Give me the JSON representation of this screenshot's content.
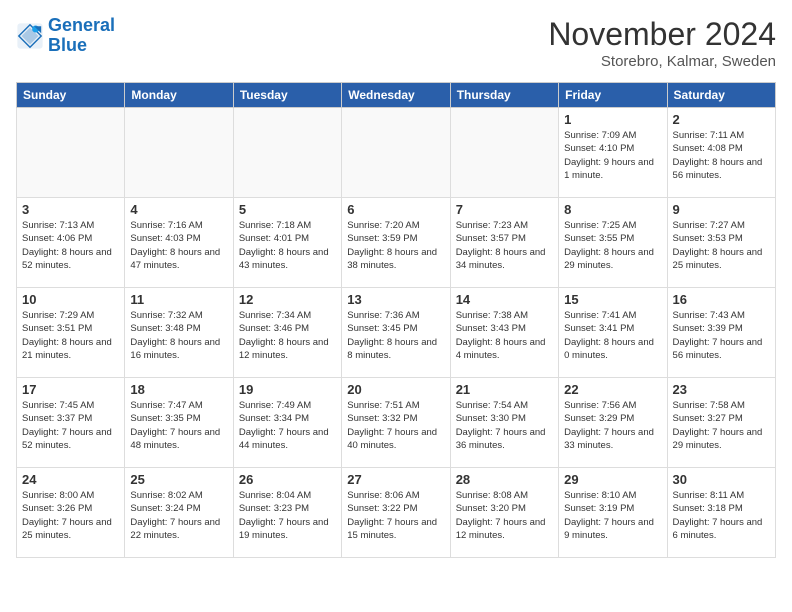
{
  "header": {
    "logo_line1": "General",
    "logo_line2": "Blue",
    "month_title": "November 2024",
    "location": "Storebro, Kalmar, Sweden"
  },
  "weekdays": [
    "Sunday",
    "Monday",
    "Tuesday",
    "Wednesday",
    "Thursday",
    "Friday",
    "Saturday"
  ],
  "weeks": [
    [
      {
        "day": "",
        "info": ""
      },
      {
        "day": "",
        "info": ""
      },
      {
        "day": "",
        "info": ""
      },
      {
        "day": "",
        "info": ""
      },
      {
        "day": "",
        "info": ""
      },
      {
        "day": "1",
        "info": "Sunrise: 7:09 AM\nSunset: 4:10 PM\nDaylight: 9 hours and 1 minute."
      },
      {
        "day": "2",
        "info": "Sunrise: 7:11 AM\nSunset: 4:08 PM\nDaylight: 8 hours and 56 minutes."
      }
    ],
    [
      {
        "day": "3",
        "info": "Sunrise: 7:13 AM\nSunset: 4:06 PM\nDaylight: 8 hours and 52 minutes."
      },
      {
        "day": "4",
        "info": "Sunrise: 7:16 AM\nSunset: 4:03 PM\nDaylight: 8 hours and 47 minutes."
      },
      {
        "day": "5",
        "info": "Sunrise: 7:18 AM\nSunset: 4:01 PM\nDaylight: 8 hours and 43 minutes."
      },
      {
        "day": "6",
        "info": "Sunrise: 7:20 AM\nSunset: 3:59 PM\nDaylight: 8 hours and 38 minutes."
      },
      {
        "day": "7",
        "info": "Sunrise: 7:23 AM\nSunset: 3:57 PM\nDaylight: 8 hours and 34 minutes."
      },
      {
        "day": "8",
        "info": "Sunrise: 7:25 AM\nSunset: 3:55 PM\nDaylight: 8 hours and 29 minutes."
      },
      {
        "day": "9",
        "info": "Sunrise: 7:27 AM\nSunset: 3:53 PM\nDaylight: 8 hours and 25 minutes."
      }
    ],
    [
      {
        "day": "10",
        "info": "Sunrise: 7:29 AM\nSunset: 3:51 PM\nDaylight: 8 hours and 21 minutes."
      },
      {
        "day": "11",
        "info": "Sunrise: 7:32 AM\nSunset: 3:48 PM\nDaylight: 8 hours and 16 minutes."
      },
      {
        "day": "12",
        "info": "Sunrise: 7:34 AM\nSunset: 3:46 PM\nDaylight: 8 hours and 12 minutes."
      },
      {
        "day": "13",
        "info": "Sunrise: 7:36 AM\nSunset: 3:45 PM\nDaylight: 8 hours and 8 minutes."
      },
      {
        "day": "14",
        "info": "Sunrise: 7:38 AM\nSunset: 3:43 PM\nDaylight: 8 hours and 4 minutes."
      },
      {
        "day": "15",
        "info": "Sunrise: 7:41 AM\nSunset: 3:41 PM\nDaylight: 8 hours and 0 minutes."
      },
      {
        "day": "16",
        "info": "Sunrise: 7:43 AM\nSunset: 3:39 PM\nDaylight: 7 hours and 56 minutes."
      }
    ],
    [
      {
        "day": "17",
        "info": "Sunrise: 7:45 AM\nSunset: 3:37 PM\nDaylight: 7 hours and 52 minutes."
      },
      {
        "day": "18",
        "info": "Sunrise: 7:47 AM\nSunset: 3:35 PM\nDaylight: 7 hours and 48 minutes."
      },
      {
        "day": "19",
        "info": "Sunrise: 7:49 AM\nSunset: 3:34 PM\nDaylight: 7 hours and 44 minutes."
      },
      {
        "day": "20",
        "info": "Sunrise: 7:51 AM\nSunset: 3:32 PM\nDaylight: 7 hours and 40 minutes."
      },
      {
        "day": "21",
        "info": "Sunrise: 7:54 AM\nSunset: 3:30 PM\nDaylight: 7 hours and 36 minutes."
      },
      {
        "day": "22",
        "info": "Sunrise: 7:56 AM\nSunset: 3:29 PM\nDaylight: 7 hours and 33 minutes."
      },
      {
        "day": "23",
        "info": "Sunrise: 7:58 AM\nSunset: 3:27 PM\nDaylight: 7 hours and 29 minutes."
      }
    ],
    [
      {
        "day": "24",
        "info": "Sunrise: 8:00 AM\nSunset: 3:26 PM\nDaylight: 7 hours and 25 minutes."
      },
      {
        "day": "25",
        "info": "Sunrise: 8:02 AM\nSunset: 3:24 PM\nDaylight: 7 hours and 22 minutes."
      },
      {
        "day": "26",
        "info": "Sunrise: 8:04 AM\nSunset: 3:23 PM\nDaylight: 7 hours and 19 minutes."
      },
      {
        "day": "27",
        "info": "Sunrise: 8:06 AM\nSunset: 3:22 PM\nDaylight: 7 hours and 15 minutes."
      },
      {
        "day": "28",
        "info": "Sunrise: 8:08 AM\nSunset: 3:20 PM\nDaylight: 7 hours and 12 minutes."
      },
      {
        "day": "29",
        "info": "Sunrise: 8:10 AM\nSunset: 3:19 PM\nDaylight: 7 hours and 9 minutes."
      },
      {
        "day": "30",
        "info": "Sunrise: 8:11 AM\nSunset: 3:18 PM\nDaylight: 7 hours and 6 minutes."
      }
    ]
  ]
}
